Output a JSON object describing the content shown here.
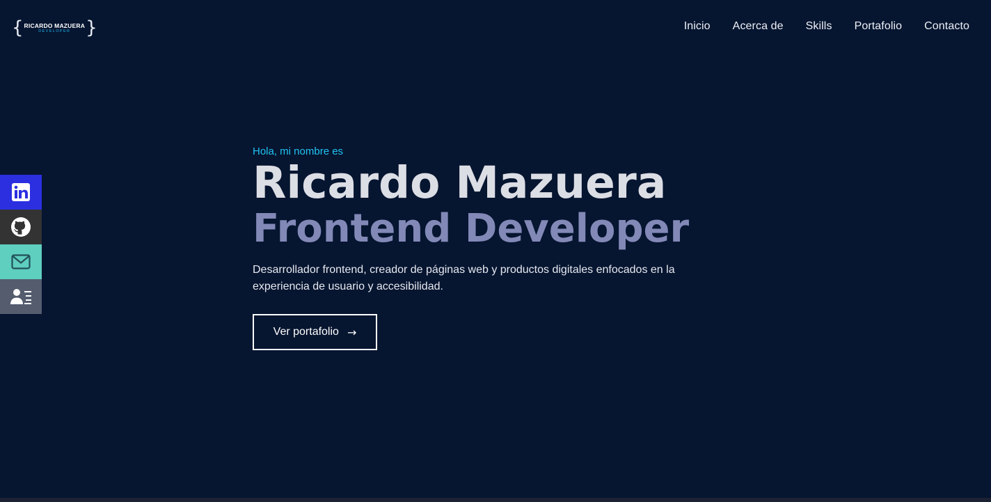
{
  "logo": {
    "name": "RICARDO MAZUERA",
    "sub": "DEVELOPER",
    "brace_open": "{",
    "brace_close": "}"
  },
  "nav": {
    "items": [
      {
        "label": "Inicio"
      },
      {
        "label": "Acerca de"
      },
      {
        "label": "Skills"
      },
      {
        "label": "Portafolio"
      },
      {
        "label": "Contacto"
      }
    ]
  },
  "social": {
    "items": [
      {
        "icon": "linkedin-icon",
        "color": "#2b2fe0"
      },
      {
        "icon": "github-icon",
        "color": "#333333"
      },
      {
        "icon": "mail-icon",
        "color": "#5fcfbf"
      },
      {
        "icon": "resume-icon",
        "color": "#545c6e"
      }
    ]
  },
  "hero": {
    "greeting": "Hola, mi nombre es",
    "name": "Ricardo Mazuera",
    "role": "Frontend Developer",
    "description": "Desarrollador frontend, creador de páginas web y productos digitales enfocados en la experiencia de usuario y accesibilidad.",
    "cta_label": "Ver portafolio",
    "cta_arrow": "→"
  },
  "colors": {
    "background": "#061530",
    "accent": "#22c3f2",
    "role_text": "#8289b7",
    "name_text": "#dcdee5"
  }
}
